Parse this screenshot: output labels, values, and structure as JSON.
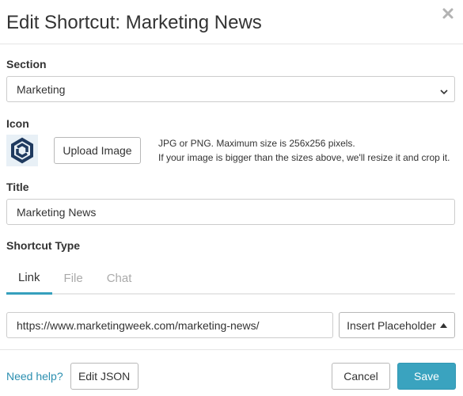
{
  "dialog": {
    "title": "Edit Shortcut: Marketing News"
  },
  "section": {
    "label": "Section",
    "value": "Marketing"
  },
  "icon": {
    "label": "Icon",
    "upload_label": "Upload Image",
    "hint_line1": "JPG or PNG. Maximum size is 256x256 pixels.",
    "hint_line2": "If your image is bigger than the sizes above, we'll resize it and crop it."
  },
  "title_field": {
    "label": "Title",
    "value": "Marketing News"
  },
  "shortcut_type": {
    "label": "Shortcut Type",
    "tabs": [
      {
        "label": "Link",
        "active": true
      },
      {
        "label": "File",
        "active": false
      },
      {
        "label": "Chat",
        "active": false
      }
    ]
  },
  "link": {
    "url": "https://www.marketingweek.com/marketing-news/",
    "insert_label": "Insert Placeholder"
  },
  "footer": {
    "help_label": "Need help?",
    "edit_json_label": "Edit JSON",
    "cancel_label": "Cancel",
    "save_label": "Save"
  },
  "colors": {
    "accent": "#3aa3bf",
    "link": "#2b8fb0",
    "icon_bg": "#e8f0f6",
    "icon_fg": "#1f3a5f"
  }
}
